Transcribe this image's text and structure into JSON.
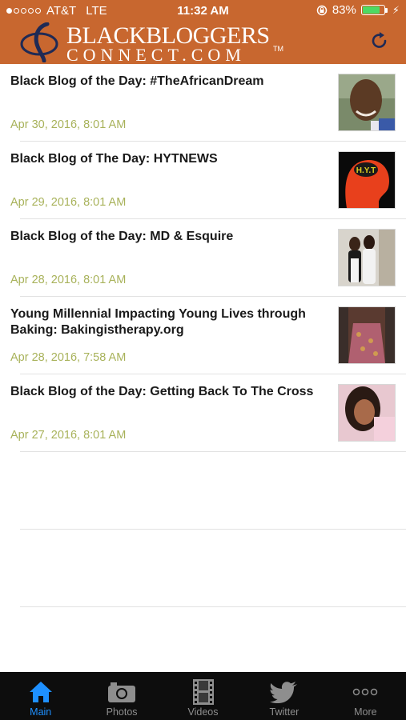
{
  "status": {
    "carrier": "AT&T",
    "network": "LTE",
    "time": "11:32 AM",
    "battery": "83%",
    "battery_level": 0.83,
    "signal_bars_filled": 1
  },
  "header": {
    "brand_line1": "BLACKBLOGGERS",
    "brand_line2": "CONNECT.COM",
    "brand_tm": "TM",
    "refresh_icon": "refresh-icon"
  },
  "posts": [
    {
      "title": "Black Blog of the Day: #TheAfricanDream",
      "date": "Apr 30, 2016, 8:01 AM",
      "thumb": "portrait-man"
    },
    {
      "title": "Black Blog of The Day: HYTNEWS",
      "date": "Apr 29, 2016, 8:01 AM",
      "thumb": "hyt-logo",
      "thumb_text": "H.Y.T"
    },
    {
      "title": "Black Blog of the Day: MD & Esquire",
      "date": "Apr 28, 2016, 8:01 AM",
      "thumb": "two-women"
    },
    {
      "title": "Young Millennial Impacting Young Lives through Baking: Bakingistherapy.org",
      "date": "Apr 28, 2016, 7:58 AM",
      "thumb": "dress-photo"
    },
    {
      "title": "Black Blog of the Day: Getting Back To The Cross",
      "date": "Apr 27, 2016, 8:01 AM",
      "thumb": "woman-portrait"
    }
  ],
  "tabs": [
    {
      "label": "Main",
      "icon": "home-icon",
      "active": true
    },
    {
      "label": "Photos",
      "icon": "camera-icon",
      "active": false
    },
    {
      "label": "Videos",
      "icon": "film-icon",
      "active": false
    },
    {
      "label": "Twitter",
      "icon": "bird-icon",
      "active": false
    },
    {
      "label": "More",
      "icon": "more-icon",
      "active": false
    }
  ],
  "colors": {
    "header": "#c8672f",
    "date": "#a8b25a",
    "tab_active": "#1e90ff",
    "tabbar": "#0d0d0d"
  }
}
